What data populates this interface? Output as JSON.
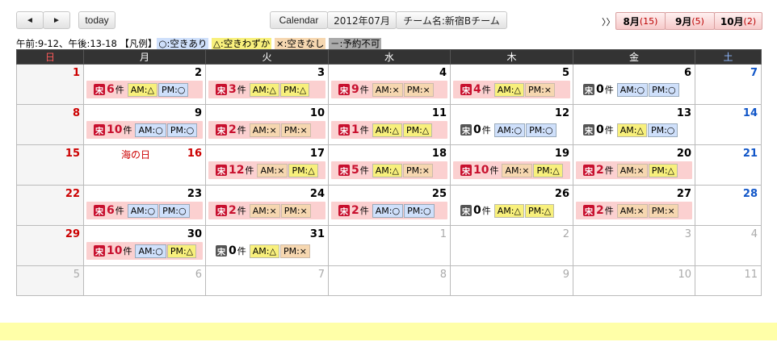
{
  "toolbar": {
    "prev_icon": "◄",
    "next_icon": "►",
    "today": "today",
    "calendar": "Calendar",
    "month": "2012年07月",
    "team": "チーム名:新宿Bチーム",
    "more": "〉〉"
  },
  "months": [
    {
      "label": "8月",
      "count": "(15)"
    },
    {
      "label": "9月",
      "count": "(5)"
    },
    {
      "label": "10月",
      "count": "(2)"
    }
  ],
  "legend": {
    "hours": "午前:9-12、午後:13-18",
    "title": "【凡例】",
    "available": "○:空きあり",
    "few": "△:空きわずか",
    "none": "×:空きなし",
    "closed": "－:予約不可"
  },
  "weekdays": [
    "日",
    "月",
    "火",
    "水",
    "木",
    "金",
    "土"
  ],
  "unit": "件",
  "weeks": [
    [
      {
        "day": "1",
        "cls": "sun",
        "entry": null
      },
      {
        "day": "2",
        "entry": {
          "icon": "red",
          "count": "6",
          "am": "△",
          "pm": "○"
        }
      },
      {
        "day": "3",
        "entry": {
          "icon": "red",
          "count": "3",
          "am": "△",
          "pm": "△"
        }
      },
      {
        "day": "4",
        "entry": {
          "icon": "red",
          "count": "9",
          "am": "×",
          "pm": "×"
        }
      },
      {
        "day": "5",
        "entry": {
          "icon": "red",
          "count": "4",
          "am": "△",
          "pm": "×"
        }
      },
      {
        "day": "6",
        "entry": {
          "icon": "gray",
          "count": "0",
          "am": "○",
          "pm": "○"
        }
      },
      {
        "day": "7",
        "cls": "sat",
        "entry": null
      }
    ],
    [
      {
        "day": "8",
        "cls": "sun",
        "entry": null
      },
      {
        "day": "9",
        "entry": {
          "icon": "red",
          "count": "10",
          "am": "○",
          "pm": "○"
        }
      },
      {
        "day": "10",
        "entry": {
          "icon": "red",
          "count": "2",
          "am": "×",
          "pm": "×"
        }
      },
      {
        "day": "11",
        "entry": {
          "icon": "red",
          "count": "1",
          "am": "△",
          "pm": "△"
        }
      },
      {
        "day": "12",
        "entry": {
          "icon": "gray",
          "count": "0",
          "am": "○",
          "pm": "○"
        }
      },
      {
        "day": "13",
        "entry": {
          "icon": "gray",
          "count": "0",
          "am": "△",
          "pm": "○"
        }
      },
      {
        "day": "14",
        "cls": "sat",
        "entry": null
      }
    ],
    [
      {
        "day": "15",
        "cls": "sun",
        "entry": null
      },
      {
        "day": "16",
        "holiday": "海の日",
        "cls": "sun",
        "entry": null
      },
      {
        "day": "17",
        "entry": {
          "icon": "red",
          "count": "12",
          "am": "×",
          "pm": "△"
        }
      },
      {
        "day": "18",
        "entry": {
          "icon": "red",
          "count": "5",
          "am": "△",
          "pm": "×"
        }
      },
      {
        "day": "19",
        "entry": {
          "icon": "red",
          "count": "10",
          "am": "×",
          "pm": "△"
        }
      },
      {
        "day": "20",
        "entry": {
          "icon": "red",
          "count": "2",
          "am": "×",
          "pm": "△"
        }
      },
      {
        "day": "21",
        "cls": "sat",
        "entry": null
      }
    ],
    [
      {
        "day": "22",
        "cls": "sun",
        "entry": null
      },
      {
        "day": "23",
        "entry": {
          "icon": "red",
          "count": "6",
          "am": "○",
          "pm": "○"
        }
      },
      {
        "day": "24",
        "entry": {
          "icon": "red",
          "count": "2",
          "am": "×",
          "pm": "×"
        }
      },
      {
        "day": "25",
        "entry": {
          "icon": "red",
          "count": "2",
          "am": "○",
          "pm": "○"
        }
      },
      {
        "day": "26",
        "entry": {
          "icon": "gray",
          "count": "0",
          "am": "△",
          "pm": "△"
        }
      },
      {
        "day": "27",
        "entry": {
          "icon": "red",
          "count": "2",
          "am": "×",
          "pm": "×"
        }
      },
      {
        "day": "28",
        "cls": "sat",
        "entry": null
      }
    ],
    [
      {
        "day": "29",
        "cls": "sun",
        "entry": null
      },
      {
        "day": "30",
        "entry": {
          "icon": "red",
          "count": "10",
          "am": "○",
          "pm": "△"
        }
      },
      {
        "day": "31",
        "entry": {
          "icon": "gray",
          "count": "0",
          "am": "△",
          "pm": "×"
        }
      },
      {
        "day": "1",
        "other": true,
        "entry": null
      },
      {
        "day": "2",
        "other": true,
        "entry": null
      },
      {
        "day": "3",
        "other": true,
        "entry": null
      },
      {
        "day": "4",
        "other": true,
        "cls": "sat",
        "entry": null
      }
    ],
    [
      {
        "day": "5",
        "other": true,
        "cls": "sun",
        "entry": null
      },
      {
        "day": "6",
        "other": true,
        "entry": null
      },
      {
        "day": "7",
        "other": true,
        "entry": null
      },
      {
        "day": "8",
        "other": true,
        "entry": null
      },
      {
        "day": "9",
        "other": true,
        "entry": null
      },
      {
        "day": "10",
        "other": true,
        "entry": null
      },
      {
        "day": "11",
        "other": true,
        "cls": "sat",
        "entry": null
      }
    ]
  ],
  "icon_label": "宋",
  "am_label": "AM:",
  "pm_label": "PM:"
}
